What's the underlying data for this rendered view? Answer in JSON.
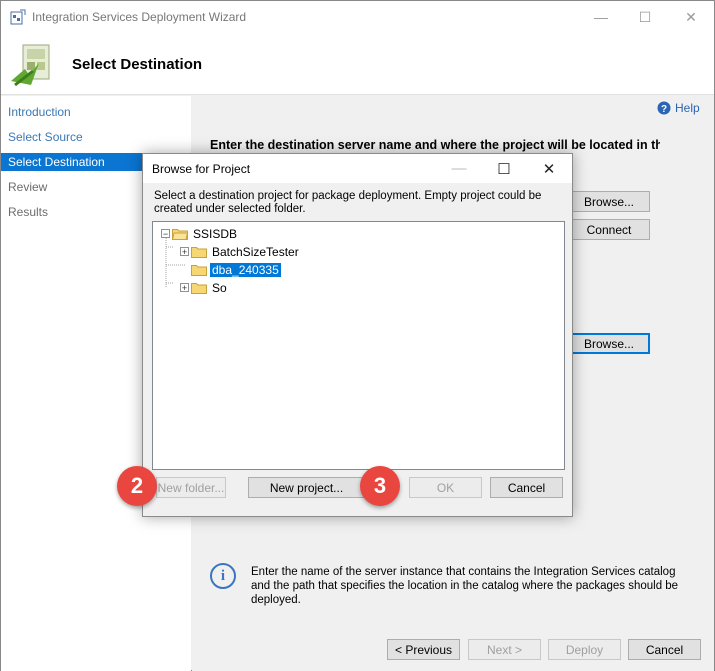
{
  "window": {
    "title": "Integration Services Deployment Wizard",
    "minimize_glyph": "—",
    "maximize_glyph": "☐",
    "close_glyph": "✕"
  },
  "header": {
    "page_title": "Select Destination"
  },
  "sidebar": {
    "items": [
      {
        "label": "Introduction",
        "state": "link"
      },
      {
        "label": "Select Source",
        "state": "link"
      },
      {
        "label": "Select Destination",
        "state": "active"
      },
      {
        "label": "Review",
        "state": "disabled"
      },
      {
        "label": "Results",
        "state": "disabled"
      }
    ]
  },
  "content": {
    "help_label": "Help",
    "instruction": "Enter the destination server name and where the project will be located in the",
    "browse_server_label": "Browse...",
    "connect_label": "Connect",
    "browse_path_label": "Browse...",
    "info_text": "Enter the name of the server instance that contains the Integration Services catalog and the path that specifies the location in the catalog where the packages should be deployed."
  },
  "footer": {
    "previous_label": "< Previous",
    "next_label": "Next >",
    "deploy_label": "Deploy",
    "cancel_label": "Cancel"
  },
  "dialog": {
    "title": "Browse for Project",
    "minimize_glyph": "—",
    "maximize_glyph": "☐",
    "close_glyph": "✕",
    "description": "Select a destination project for package deployment. Empty project could be created under selected folder.",
    "tree": {
      "root": {
        "label": "SSISDB",
        "expander": "−"
      },
      "children": [
        {
          "label": "BatchSizeTester",
          "expander": "+",
          "selected": false
        },
        {
          "label": "dba_240335",
          "expander": "",
          "selected": true
        },
        {
          "label": "So",
          "expander": "+",
          "selected": false
        }
      ]
    },
    "new_folder_label": "New folder...",
    "new_project_label": "New project...",
    "ok_label": "OK",
    "cancel_label": "Cancel"
  },
  "annotations": {
    "badge_2": "2",
    "badge_3": "3"
  },
  "colors": {
    "selection": "#0078d7",
    "nav_active": "#0b75d2",
    "link": "#3c78b4",
    "badge": "#e8463f"
  },
  "icons": [
    "app-icon",
    "wizard-graphic-icon",
    "help-icon",
    "info-icon",
    "folder-icon",
    "expander-icon"
  ]
}
